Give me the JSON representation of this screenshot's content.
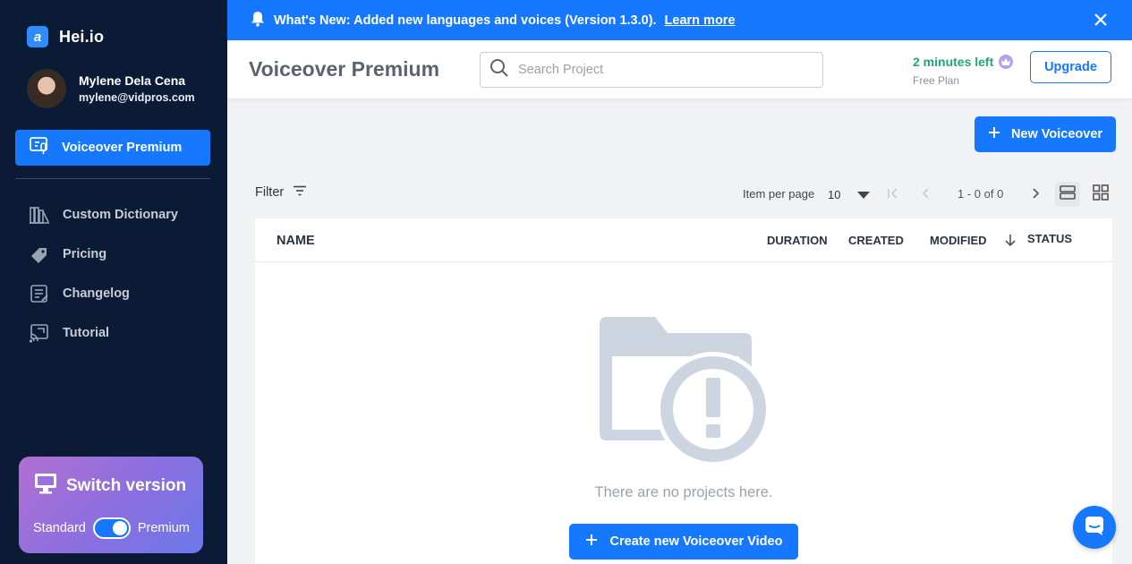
{
  "brand": {
    "name": "Hei.io",
    "logo_letter": "a"
  },
  "user": {
    "name": "Mylene Dela Cena",
    "email": "mylene@vidpros.com"
  },
  "sidebar": {
    "active_item": {
      "label": "Voiceover Premium",
      "icon": "mic-monitor-icon"
    },
    "items": [
      {
        "label": "Custom Dictionary",
        "icon": "books-icon"
      },
      {
        "label": "Pricing",
        "icon": "price-tag-icon"
      },
      {
        "label": "Changelog",
        "icon": "changelog-icon"
      },
      {
        "label": "Tutorial",
        "icon": "cast-icon"
      }
    ],
    "switch_card": {
      "title": "Switch version",
      "left_label": "Standard",
      "right_label": "Premium",
      "toggle_on": true
    }
  },
  "announcement": {
    "text": "What's New: Added new languages and voices (Version 1.3.0).",
    "link": "Learn more"
  },
  "header": {
    "title": "Voiceover Premium",
    "search_placeholder": "Search Project",
    "time_left": "2 minutes left",
    "plan": "Free Plan",
    "upgrade_label": "Upgrade"
  },
  "toolbar": {
    "new_button": "New Voiceover",
    "filter_label": "Filter",
    "per_page_label": "Item per page",
    "per_page_value": "10",
    "range": "1 - 0 of 0"
  },
  "table": {
    "columns": {
      "name": "NAME",
      "duration": "DURATION",
      "created": "CREATED",
      "modified": "MODIFIED",
      "status": "STATUS"
    },
    "rows": [],
    "empty_text": "There are no projects here.",
    "create_button": "Create new Voiceover Video"
  },
  "colors": {
    "accent": "#1677ff",
    "sidebar_bg": "#0b1b35",
    "success": "#21a67a"
  }
}
